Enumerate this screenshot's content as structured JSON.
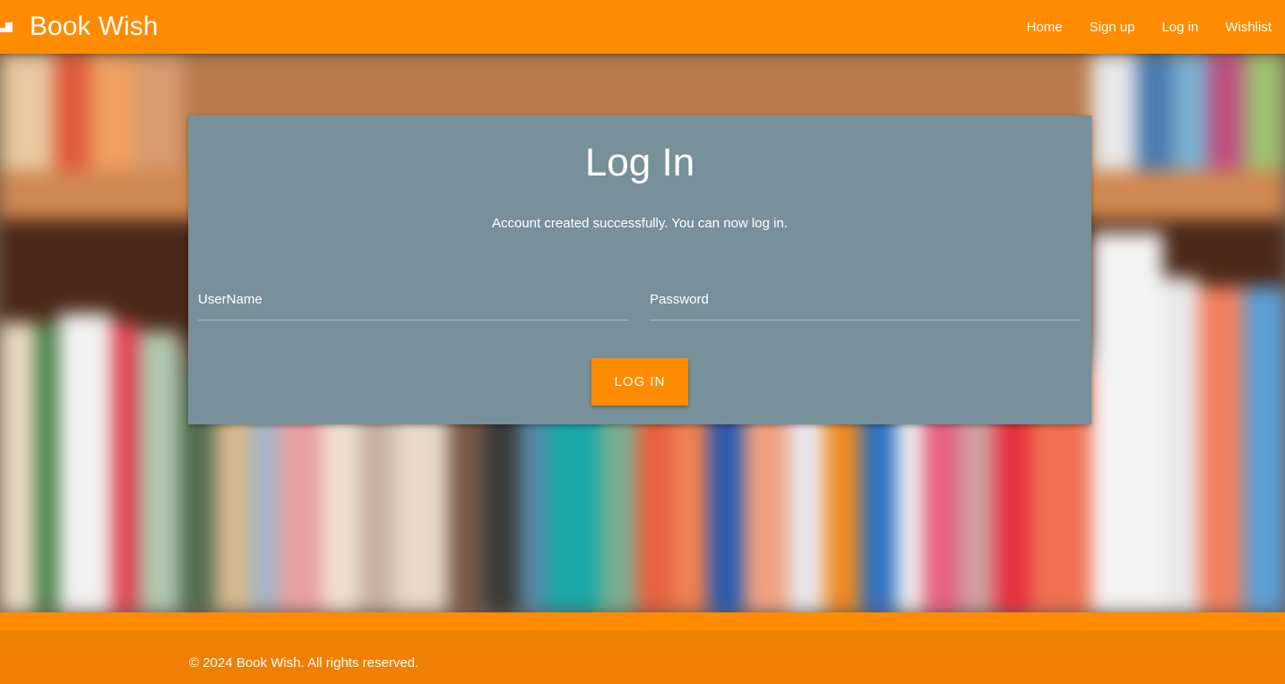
{
  "nav": {
    "brand_icon": "book-icon",
    "brand_title": "Book Wish",
    "links": [
      "Home",
      "Sign up",
      "Log in",
      "Wishlist"
    ]
  },
  "login": {
    "title": "Log In",
    "message": "Account created successfully. You can now log in.",
    "username_label": "UserName",
    "password_label": "Password",
    "button_label": "LOG IN"
  },
  "footer": {
    "copyright": "© 2024 Book Wish. All rights reserved."
  },
  "colors": {
    "brand_orange": "#ff8c00",
    "footer_orange": "#ef7f05",
    "card_gray": "#77909a"
  }
}
